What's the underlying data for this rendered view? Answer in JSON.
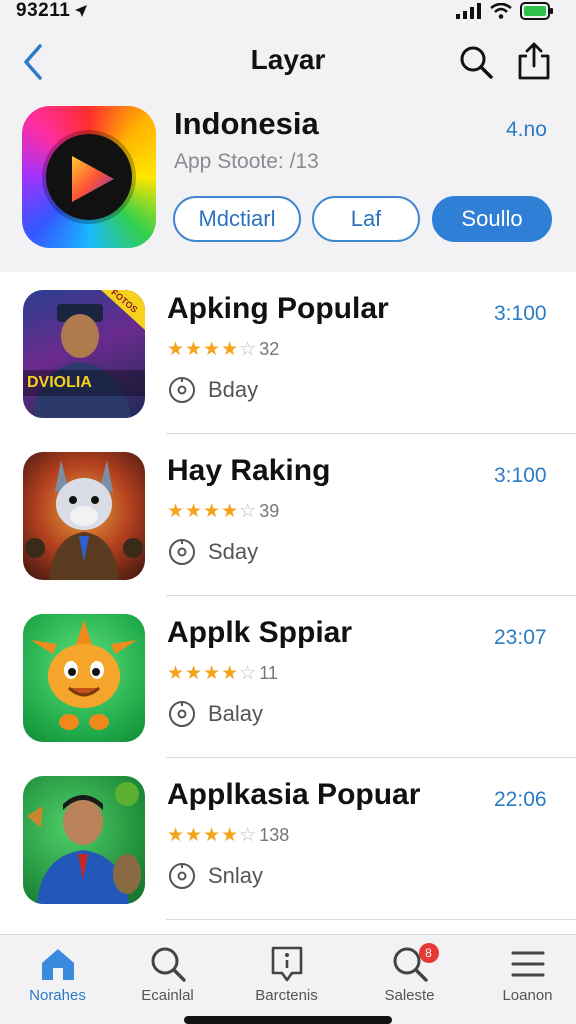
{
  "status_bar": {
    "time": "93211"
  },
  "nav": {
    "title": "Layar"
  },
  "hero": {
    "name": "Indonesia",
    "rating": "4.no",
    "subtitle": "App Stoote: /13",
    "pills": [
      "Mdctiarl",
      "Laf",
      "Soullo"
    ]
  },
  "apps": [
    {
      "title": "Apking Popular",
      "time": "3:100",
      "stars": "★★★★",
      "count": "32",
      "meta": "Bday",
      "thumb_text": "DVIOLIA",
      "thumb_badge": "FOTOS"
    },
    {
      "title": "Hay Raking",
      "time": "3:100",
      "stars": "★★★★",
      "count": "39",
      "meta": "Sday"
    },
    {
      "title": "Applk Sppiar",
      "time": "23:07",
      "stars": "★★★★",
      "count": "11",
      "meta": "Balay"
    },
    {
      "title": "Applkasia Popuar",
      "time": "22:06",
      "stars": "★★★★",
      "count": "138",
      "meta": "Snlay"
    }
  ],
  "tabs": [
    {
      "label": "Norahes",
      "icon": "home-icon",
      "active": true
    },
    {
      "label": "Ecainlal",
      "icon": "search-icon"
    },
    {
      "label": "Barctenis",
      "icon": "info-tag-icon"
    },
    {
      "label": "Saleste",
      "icon": "search-badge-icon",
      "badge": "8"
    },
    {
      "label": "Loanon",
      "icon": "menu-icon"
    }
  ],
  "colors": {
    "accent": "#2c7bc6",
    "pill_active": "#2f7fd6",
    "star": "#f4a41c"
  }
}
